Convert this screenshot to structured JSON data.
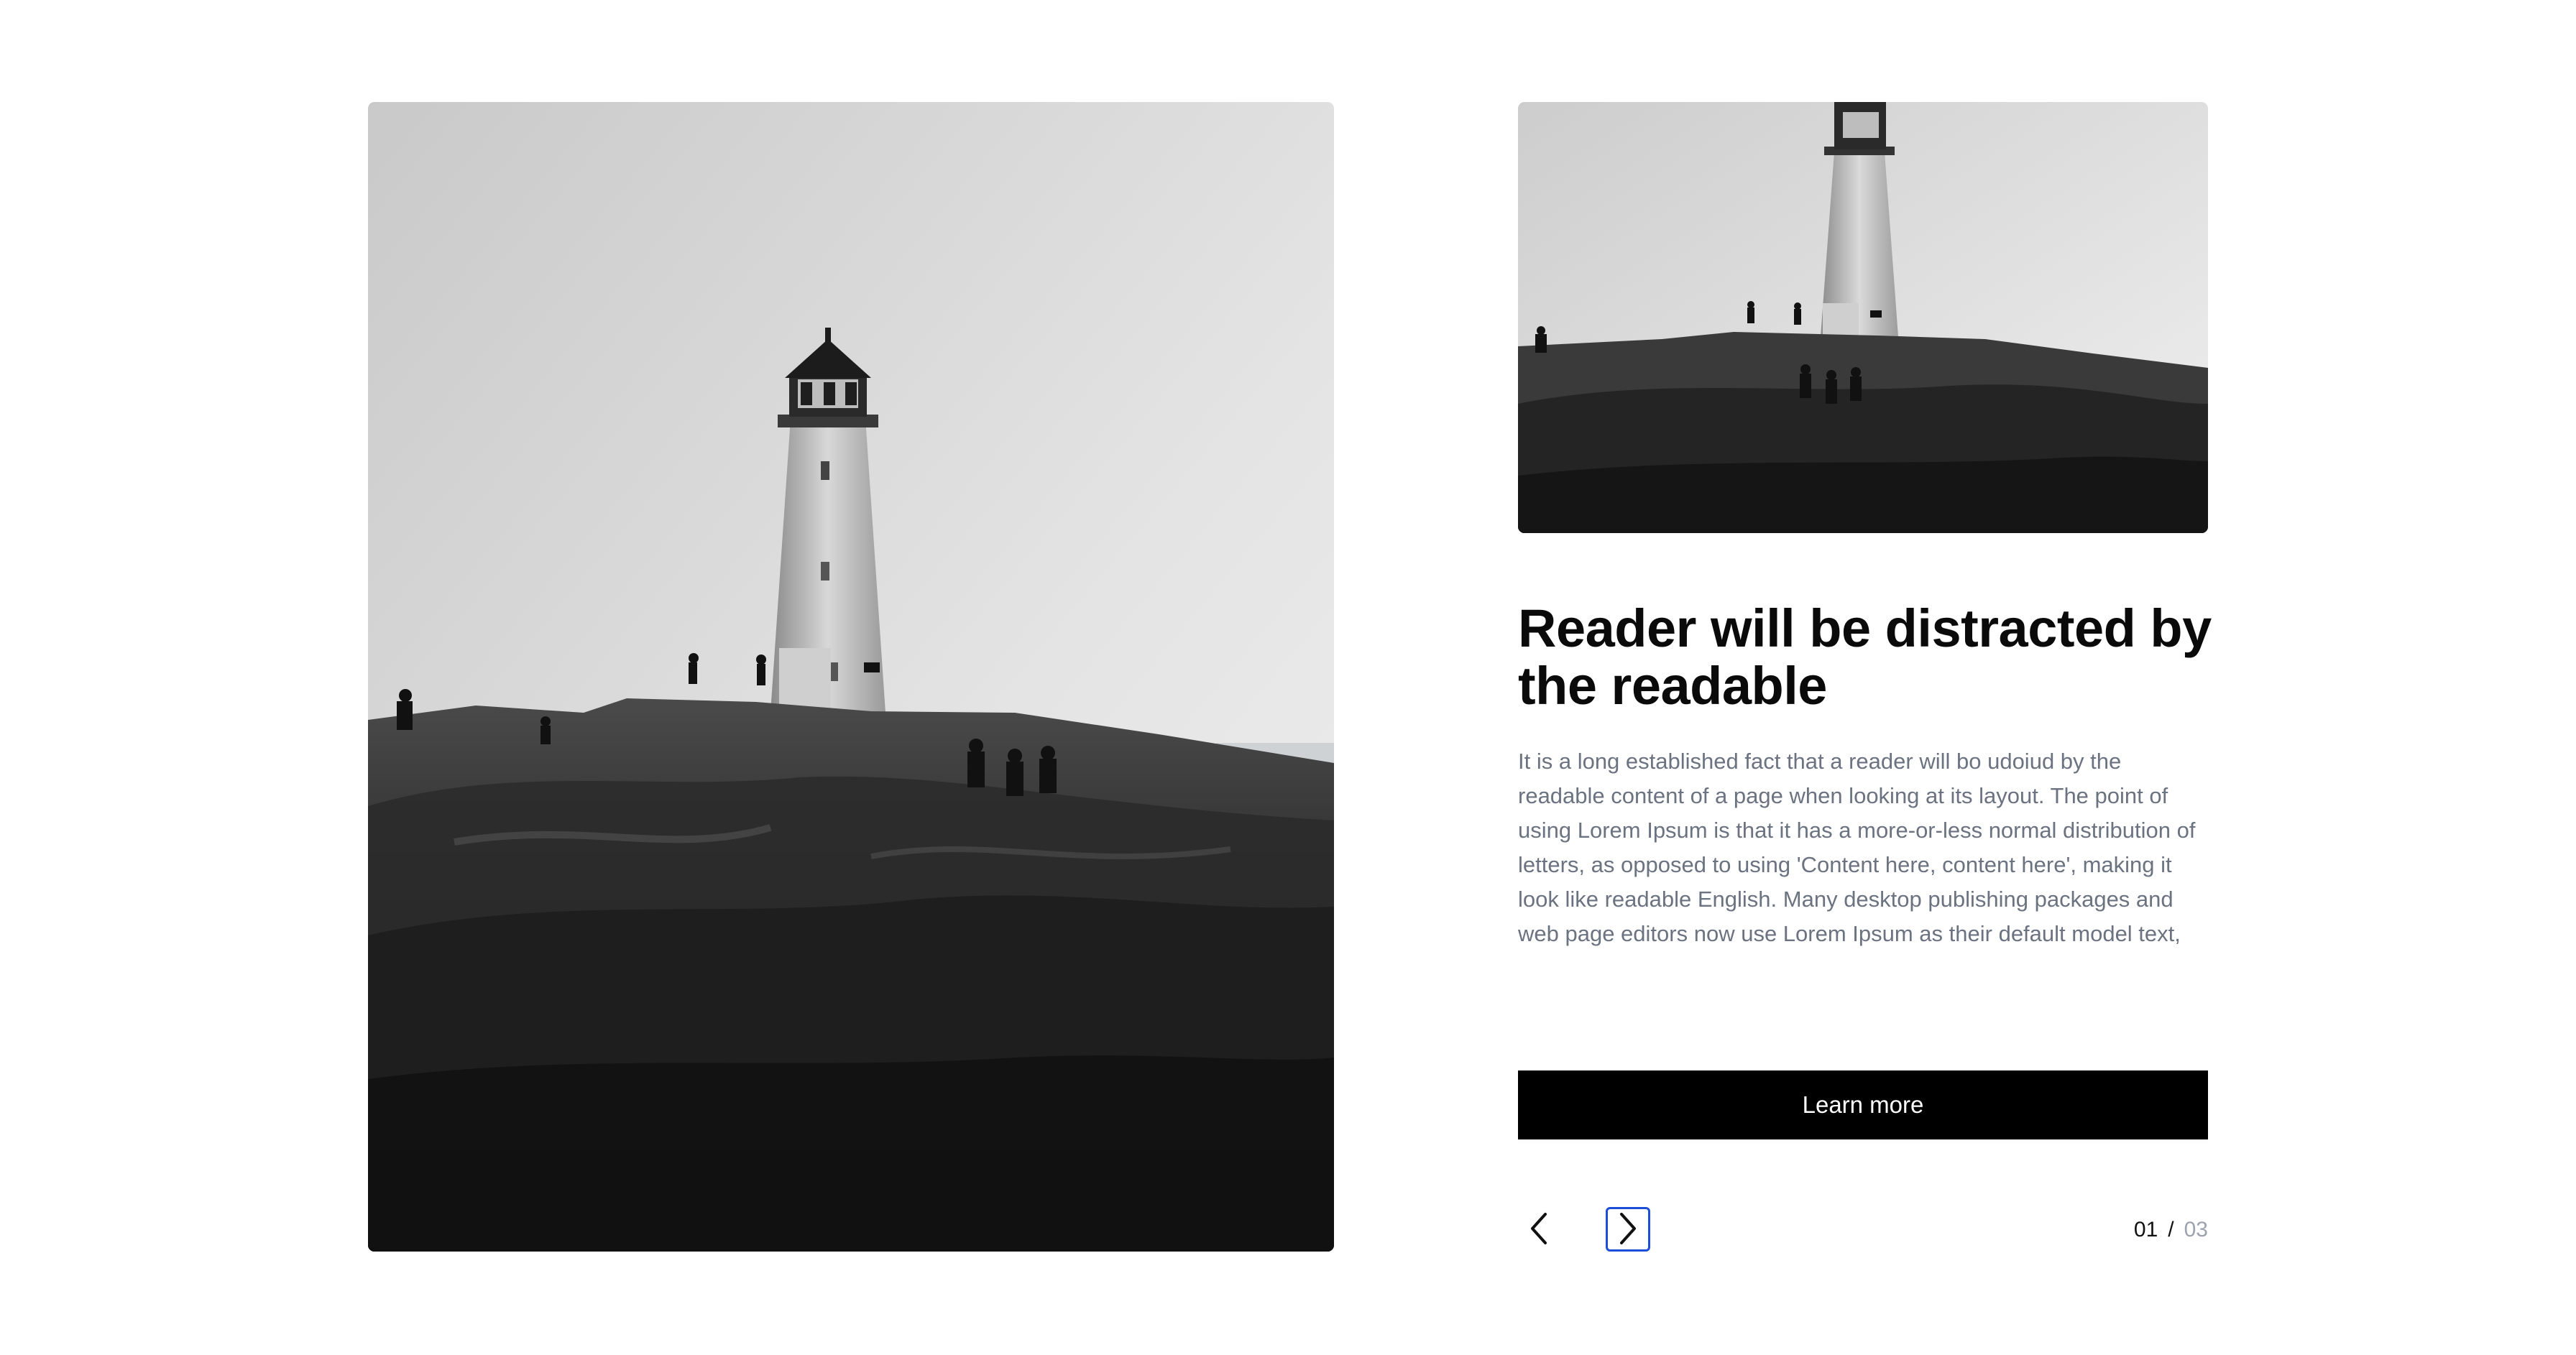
{
  "slide": {
    "title": "Reader will be distracted by the readable",
    "description": "It is a long established fact that a reader will bo udoiud by the readable content of a page when looking at its layout. The point of using Lorem Ipsum is that it has a more-or-less normal distribution of letters, as opposed to using 'Content here, content here', making it look like readable English. Many desktop publishing packages and web page editors now use Lorem Ipsum as their default model text,",
    "cta_label": "Learn more"
  },
  "pagination": {
    "current": "01",
    "separator": "/",
    "total": "03"
  },
  "icons": {
    "prev": "chevron-left-icon",
    "next": "chevron-right-icon"
  },
  "colors": {
    "cta_background": "#000000",
    "cta_text": "#ffffff",
    "focus_ring": "#1d4ed8",
    "description_text": "#6b7280",
    "muted_counter": "#9ca3af"
  }
}
